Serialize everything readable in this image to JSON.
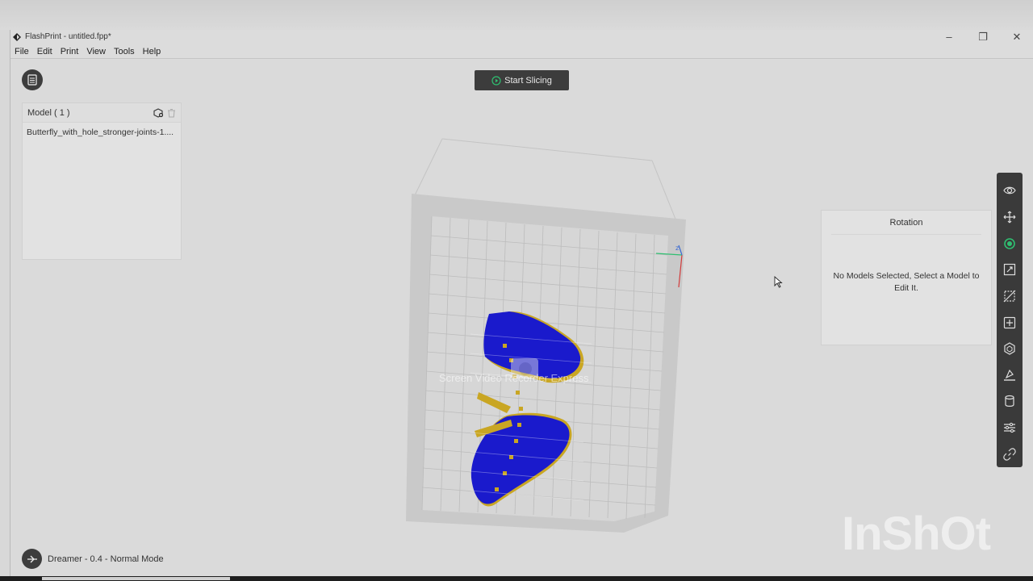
{
  "window": {
    "title": "FlashPrint - untitled.fpp*",
    "controls": [
      "minimize-icon",
      "restore-icon",
      "close-icon"
    ]
  },
  "menu": [
    "File",
    "Edit",
    "Print",
    "View",
    "Tools",
    "Help"
  ],
  "toolbar_top": {
    "file_button_icon": "document-icon",
    "start_slicing": "Start Slicing"
  },
  "model_panel": {
    "title": "Model ( 1 )",
    "items": [
      "Butterfly_with_hole_stronger-joints-1...."
    ]
  },
  "rotation_panel": {
    "title": "Rotation",
    "message": "No Models Selected, Select a Model to Edit It."
  },
  "right_toolbar": [
    {
      "name": "view-icon",
      "active": false
    },
    {
      "name": "move-icon",
      "active": false
    },
    {
      "name": "rotate-icon",
      "active": true
    },
    {
      "name": "scale-icon",
      "active": false
    },
    {
      "name": "cut-icon",
      "active": false
    },
    {
      "name": "add-support-icon",
      "active": false
    },
    {
      "name": "hollow-icon",
      "active": false
    },
    {
      "name": "level-icon",
      "active": false
    },
    {
      "name": "cylinder-icon",
      "active": false
    },
    {
      "name": "settings-sliders-icon",
      "active": false
    },
    {
      "name": "link-icon",
      "active": false
    }
  ],
  "status": {
    "machine": "Dreamer - 0.4 - Normal Mode"
  },
  "overlays": {
    "recorder_watermark": "Screen Video Recorder Express",
    "inshot_logo": "InShOt"
  },
  "colors": {
    "accent_active": "#2fbf71",
    "model_blue": "#1a1acc",
    "model_yellow": "#c9a623",
    "dark_ui": "#3a3a3a"
  },
  "video_progress": 0.19
}
